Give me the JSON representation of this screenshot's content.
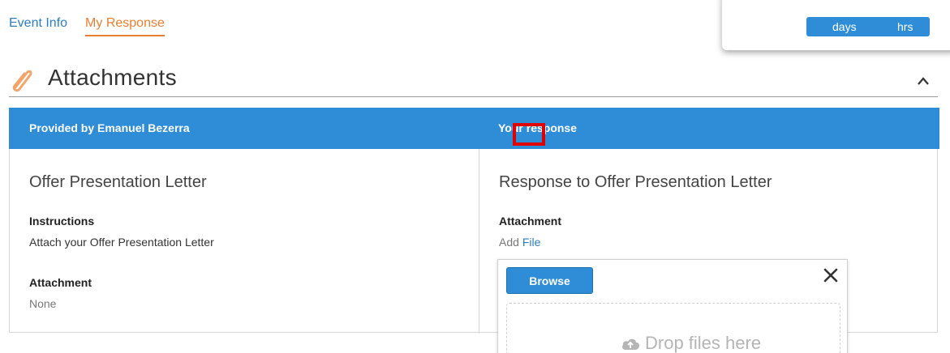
{
  "tabs": [
    {
      "label": "Event Info",
      "active": false
    },
    {
      "label": "My Response",
      "active": true
    }
  ],
  "countdown": {
    "unit_days": "days",
    "unit_hrs": "hrs"
  },
  "section": {
    "title": "Attachments",
    "icon": "paperclip-icon",
    "collapse_icon": "chevron-up-icon"
  },
  "table": {
    "header_left": "Provided by Emanuel Bezerra",
    "header_right": "Your response",
    "left": {
      "title": "Offer Presentation Letter",
      "instructions_label": "Instructions",
      "instructions_value": "Attach your Offer Presentation Letter",
      "attachment_label": "Attachment",
      "attachment_value": "None"
    },
    "right": {
      "title": "Response to Offer Presentation Letter",
      "attachment_label": "Attachment",
      "add_prefix": "Add",
      "file_link": "File"
    }
  },
  "upload": {
    "browse_label": "Browse",
    "drop_text": "Drop files here",
    "close_icon": "close-icon",
    "cloud_icon": "cloud-upload-icon"
  },
  "colors": {
    "accent_blue": "#2e8dd6",
    "active_orange": "#e97e2f",
    "highlight_red": "#e00000"
  }
}
